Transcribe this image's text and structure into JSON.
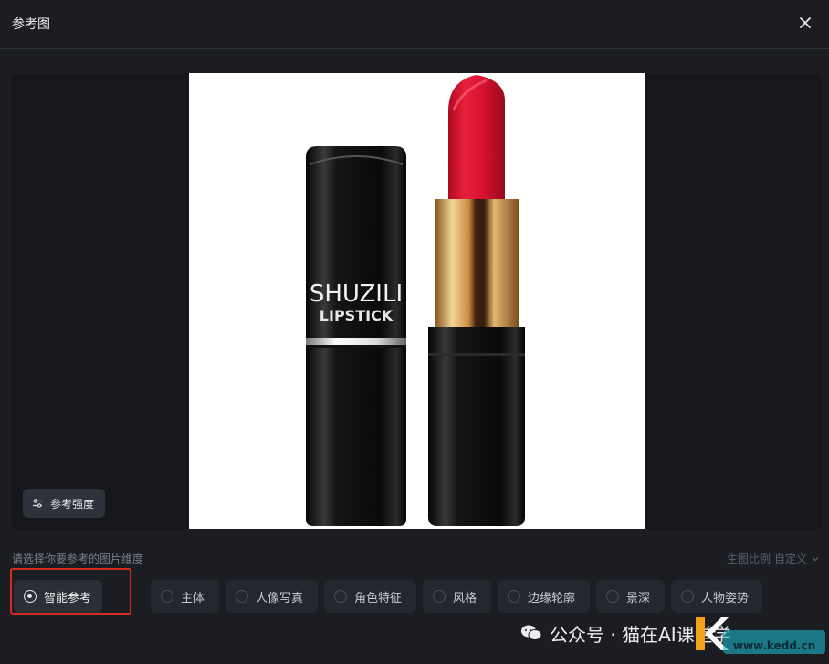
{
  "dialog": {
    "title": "参考图",
    "close_icon": "close-icon"
  },
  "preview": {
    "strength_button_label": "参考强度",
    "strength_icon": "sliders-icon",
    "product_brand": "SHUZILI",
    "product_name": "LIPSTICK",
    "colors": {
      "lipstick": "#e01432",
      "gold_band": "#d8a355",
      "tube": "#0d0d0d"
    }
  },
  "dimension_prompt": "请选择你要参考的图片维度",
  "ratio": {
    "label": "生图比例",
    "value": "自定义"
  },
  "options": [
    {
      "label": "智能参考",
      "selected": true
    },
    {
      "label": "主体",
      "selected": false
    },
    {
      "label": "人像写真",
      "selected": false
    },
    {
      "label": "角色特征",
      "selected": false
    },
    {
      "label": "风格",
      "selected": false
    },
    {
      "label": "边缘轮廓",
      "selected": false
    },
    {
      "label": "景深",
      "selected": false
    },
    {
      "label": "人物姿势",
      "selected": false
    }
  ],
  "watermark": {
    "text": "公众号 · 猫在AI课堂学",
    "domain": "www.kedd.cn"
  }
}
